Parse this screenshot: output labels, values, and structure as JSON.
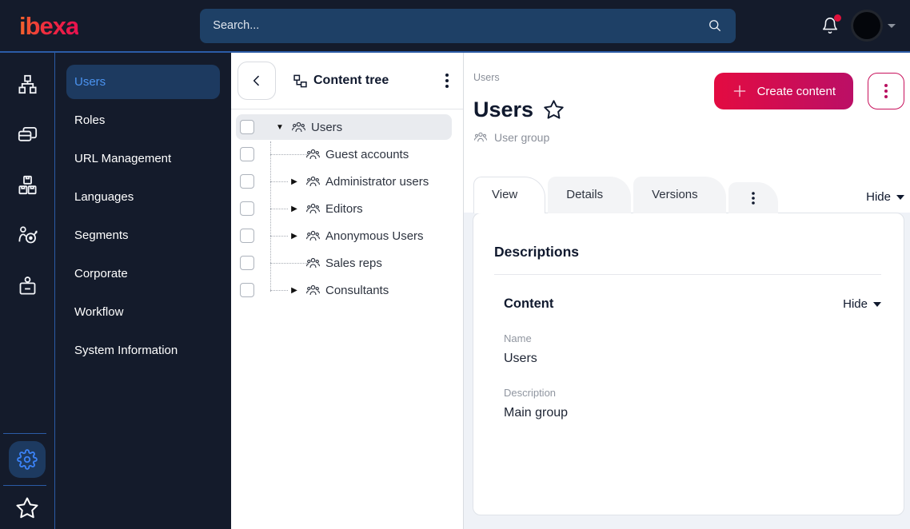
{
  "topbar": {
    "logo_text": "ibexa",
    "search_placeholder": "Search...",
    "has_notification_dot": true
  },
  "left_rail": {
    "icons": [
      "content-structure",
      "content-list",
      "product-catalog",
      "personalization",
      "corporate-account",
      "admin-settings",
      "bookmarks"
    ],
    "active_icon": "admin-settings"
  },
  "sidebar": {
    "items": [
      {
        "label": "Users",
        "active": true
      },
      {
        "label": "Roles",
        "active": false
      },
      {
        "label": "URL Management",
        "active": false
      },
      {
        "label": "Languages",
        "active": false
      },
      {
        "label": "Segments",
        "active": false
      },
      {
        "label": "Corporate",
        "active": false
      },
      {
        "label": "Workflow",
        "active": false
      },
      {
        "label": "System Information",
        "active": false
      }
    ]
  },
  "content_tree": {
    "title": "Content tree",
    "items": [
      {
        "label": "Users",
        "state": "expanded",
        "selected": true,
        "level": 0
      },
      {
        "label": "Guest accounts",
        "state": "leaf",
        "selected": false,
        "level": 1
      },
      {
        "label": "Administrator users",
        "state": "collapsed",
        "selected": false,
        "level": 1
      },
      {
        "label": "Editors",
        "state": "collapsed",
        "selected": false,
        "level": 1
      },
      {
        "label": "Anonymous Users",
        "state": "collapsed",
        "selected": false,
        "level": 1
      },
      {
        "label": "Sales reps",
        "state": "leaf",
        "selected": false,
        "level": 1
      },
      {
        "label": "Consultants",
        "state": "collapsed",
        "selected": false,
        "level": 1
      }
    ]
  },
  "main": {
    "breadcrumb": "Users",
    "create_button_label": "Create content",
    "title": "Users",
    "content_type": "User group",
    "tabs": [
      {
        "label": "View",
        "active": true
      },
      {
        "label": "Details",
        "active": false
      },
      {
        "label": "Versions",
        "active": false
      }
    ],
    "hide_label": "Hide",
    "card": {
      "heading": "Descriptions",
      "section_title": "Content",
      "section_hide_label": "Hide",
      "fields": [
        {
          "label": "Name",
          "value": "Users"
        },
        {
          "label": "Description",
          "value": "Main group"
        }
      ]
    }
  },
  "colors": {
    "topbar_bg": "#141b2b",
    "accent_line": "#2b5ba6",
    "brand_gradient_start": "#e30b41",
    "brand_gradient_end": "#bb0f66",
    "active_item_bg": "#1d3a60",
    "active_item_text": "#4b93f0",
    "gear_accent": "#3b82f6",
    "panel_bg": "#eff2f7",
    "selected_row_bg": "#e9ebef"
  }
}
